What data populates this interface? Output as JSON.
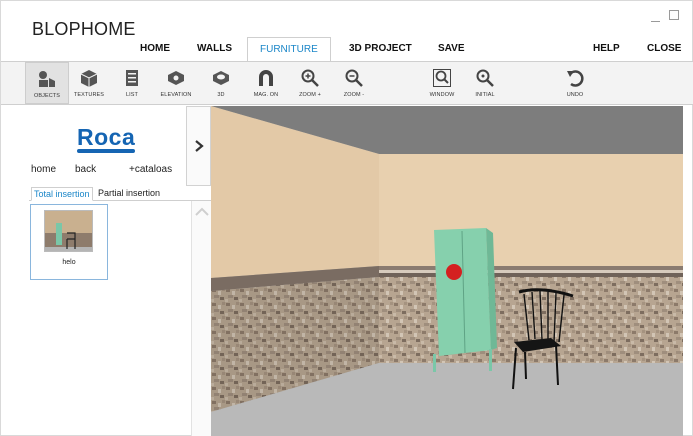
{
  "app": {
    "title": "BLOPHOME"
  },
  "menu": {
    "items": [
      {
        "id": "home",
        "label": "HOME"
      },
      {
        "id": "walls",
        "label": "WALLS"
      },
      {
        "id": "furniture",
        "label": "FURNITURE",
        "active": true
      },
      {
        "id": "project3d",
        "label": "3D PROJECT"
      },
      {
        "id": "save",
        "label": "SAVE"
      },
      {
        "id": "help",
        "label": "HELP"
      },
      {
        "id": "close",
        "label": "CLOSE"
      }
    ]
  },
  "toolbar": {
    "tools": [
      {
        "id": "objects",
        "label": "OBJECTS",
        "icon": "objects-icon",
        "active": true
      },
      {
        "id": "textures",
        "label": "TEXTURES",
        "icon": "cube-icon"
      },
      {
        "id": "list",
        "label": "LIST",
        "icon": "list-icon"
      },
      {
        "id": "elevation",
        "label": "ELEVATION",
        "icon": "elevation-icon"
      },
      {
        "id": "view3d",
        "label": "3D",
        "icon": "3d-icon"
      },
      {
        "id": "magon",
        "label": "MAG. ON",
        "icon": "magnet-icon"
      },
      {
        "id": "zoomin",
        "label": "ZOOM +",
        "icon": "zoom-in-icon"
      },
      {
        "id": "zoomout",
        "label": "ZOOM -",
        "icon": "zoom-out-icon"
      },
      {
        "id": "window",
        "label": "WINDOW",
        "icon": "zoom-window-icon"
      },
      {
        "id": "initial",
        "label": "INITIAL",
        "icon": "zoom-initial-icon"
      },
      {
        "id": "undo",
        "label": "UNDO",
        "icon": "undo-icon"
      }
    ]
  },
  "catalog": {
    "brand": "Roca",
    "links": {
      "home": "home",
      "back": "back",
      "catalogs": "+cataloas"
    }
  },
  "tabs": {
    "total": "Total insertion",
    "partial": "Partial insertion"
  },
  "items": [
    {
      "name": "helo"
    }
  ],
  "colors": {
    "accent": "#1a86c8",
    "brand": "#1565b3"
  }
}
